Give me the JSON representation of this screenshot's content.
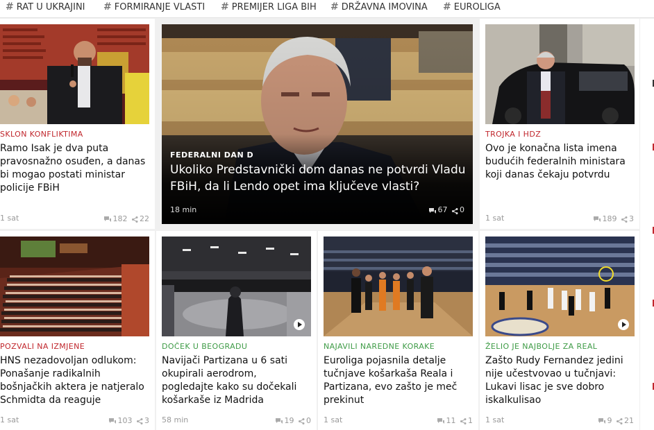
{
  "tags": [
    "RAT U UKRAJINI",
    "FORMIRANJE VLASTI",
    "PREMIJER LIGA BIH",
    "DRŽAVNA IMOVINA",
    "EUROLIGA"
  ],
  "featured": {
    "kicker": "FEDERALNI DAN D",
    "title": "Ukoliko Predstavnički dom danas ne potvrdi Vladu FBiH, da li Lendo opet ima ključeve vlasti?",
    "time": "18 min",
    "comments": "67",
    "shares": "0"
  },
  "cards": [
    {
      "kicker": "SKLON KONFLIKTIMA",
      "kicker_color": "#c0262c",
      "title": "Ramo Isak je dva puta pravosnažno osuđen, a danas bi mogao postati ministar policije FBiH",
      "time": "1 sat",
      "comments": "182",
      "shares": "22"
    },
    {
      "kicker": "TROJKA I HDZ",
      "kicker_color": "#c0262c",
      "title": "Ovo je konačna lista imena budućih federalnih ministara koji danas čekaju potvrdu",
      "time": "1 sat",
      "comments": "189",
      "shares": "3"
    },
    {
      "kicker": "POZVALI NA IZMJENE",
      "kicker_color": "#c0262c",
      "title": "HNS nezadovoljan odlukom: Ponašanje radikalnih bošnjačkih aktera je natjeralo Schmidta da reaguje",
      "time": "1 sat",
      "comments": "103",
      "shares": "3"
    },
    {
      "kicker": "DOČEK U BEOGRADU",
      "kicker_color": "#3e9b46",
      "title": "Navijači Partizana u 6 sati okupirali aerodrom, pogledajte kako su dočekali košarkaše iz Madrida",
      "time": "58 min",
      "comments": "19",
      "shares": "0"
    },
    {
      "kicker": "NAJAVILI NAREDNE KORAKE",
      "kicker_color": "#3e9b46",
      "title": "Euroliga pojasnila detalje tučnjave košarkaša Reala i Partizana, evo zašto je meč prekinut",
      "time": "1 sat",
      "comments": "11",
      "shares": "1"
    },
    {
      "kicker": "ŽELIO JE NAJBOLJE ZA REAL",
      "kicker_color": "#3e9b46",
      "title": "Zašto Rudy Fernandez jedini nije učestvovao u tučnjavi: Lukavi lisac je sve dobro iskalkulisao",
      "time": "1 sat",
      "comments": "9",
      "shares": "21"
    }
  ],
  "icons": {
    "tag": "hash-icon",
    "comments": "comments-icon",
    "shares": "share-icon",
    "video": "play-icon"
  }
}
